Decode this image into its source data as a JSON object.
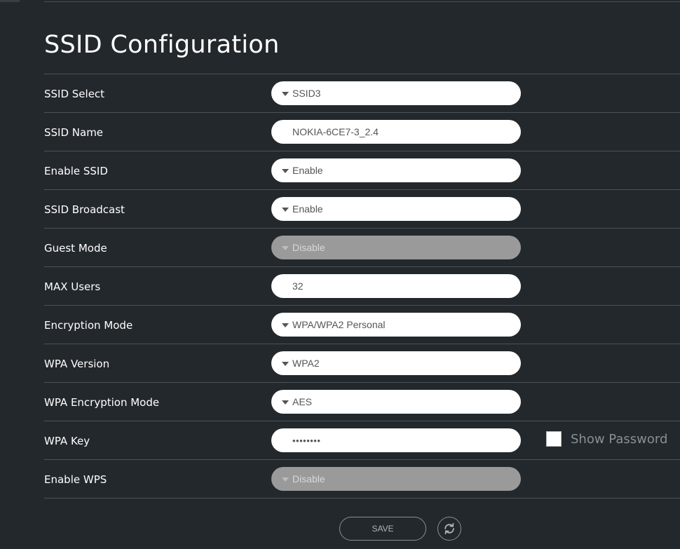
{
  "page": {
    "title": "SSID Configuration"
  },
  "form": {
    "rows": [
      {
        "label": "SSID Select",
        "type": "select",
        "value": "SSID3"
      },
      {
        "label": "SSID Name",
        "type": "text",
        "value": "NOKIA-6CE7-3_2.4"
      },
      {
        "label": "Enable SSID",
        "type": "select",
        "value": "Enable"
      },
      {
        "label": "SSID Broadcast",
        "type": "select",
        "value": "Enable"
      },
      {
        "label": "Guest Mode",
        "type": "select-disabled",
        "value": "Disable"
      },
      {
        "label": "MAX Users",
        "type": "text",
        "value": "32"
      },
      {
        "label": "Encryption Mode",
        "type": "select",
        "value": "WPA/WPA2 Personal"
      },
      {
        "label": "WPA Version",
        "type": "select",
        "value": "WPA2"
      },
      {
        "label": "WPA Encryption Mode",
        "type": "select",
        "value": "AES"
      },
      {
        "label": "WPA Key",
        "type": "password",
        "value": "••••••••"
      },
      {
        "label": "Enable WPS",
        "type": "select-disabled",
        "value": "Disable"
      }
    ],
    "show_password_label": "Show Password",
    "show_password_checked": false
  },
  "actions": {
    "save_label": "SAVE",
    "refresh_icon": "refresh-icon"
  },
  "colors": {
    "background": "#23282d",
    "field": "#ffffff",
    "field_disabled": "#9a9a9a",
    "rule": "#4d5257"
  }
}
